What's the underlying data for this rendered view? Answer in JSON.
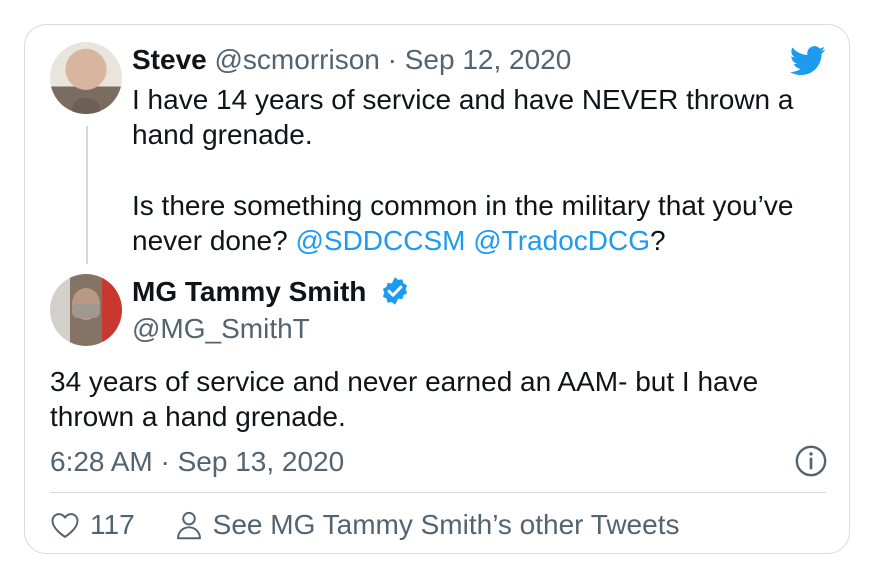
{
  "original_tweet": {
    "name": "Steve",
    "handle": "@scmorrison",
    "separator": "·",
    "date": "Sep 12, 2020",
    "text_line1": "I have 14 years of service and have NEVER thrown a hand grenade.",
    "text_line2_prefix": "Is there something common in the military that you’ve never done?",
    "mentions": [
      "@SDDCCSM",
      "@TradocDCG"
    ],
    "text_line2_suffix": "?"
  },
  "reply_tweet": {
    "name": "MG Tammy Smith",
    "handle": "@MG_SmithT",
    "text": "34 years of service and never earned an AAM- but I have thrown a hand grenade.",
    "timestamp": "6:28 AM · Sep 13, 2020",
    "likes": "117",
    "see_more": "See MG Tammy Smith’s other Tweets"
  },
  "icons": {
    "brand": "twitter-bird-icon",
    "verified": "verified-badge-icon",
    "info": "info-icon",
    "like": "heart-icon",
    "person": "person-icon"
  },
  "colors": {
    "accent": "#1d9bf0",
    "text": "#0f1419",
    "muted": "#536471",
    "border": "#d5dbe0"
  }
}
